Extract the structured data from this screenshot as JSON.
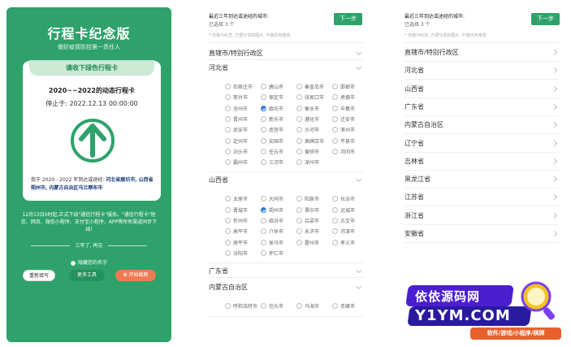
{
  "card": {
    "title": "行程卡纪念版",
    "subtitle": "做好疫情防控第一责任人",
    "ticket_header": "请收下绿色行程卡",
    "line1": "2020~~2022的动态行程卡",
    "line2": "停止于: 2022.12.13 00:00:00",
    "desc_prefix": "我于 2020 - 2022 年到达或途经:",
    "desc_places": "河北省廊坊市, 山西省朔州市, 内蒙古自治区乌兰察布市",
    "notice": "12月13日0时起,正式下线\"通信行程卡\"服务。\"通信行程卡\"短信、网页、微信小程序、支付宝小程序、APP等所有渠道同步下线!",
    "divider_text": "三年了, 再见",
    "hide_name": "隐藏您的名字",
    "btn_refill": "重新填写",
    "btn_tools": "更多工具",
    "btn_screenshot": "开始截图",
    "arrow_color": "#2ea26a"
  },
  "middle": {
    "title": "最近三年到达或途经的城市:",
    "selected": "已选择 3 个",
    "tip": "* 仅做为纪念, 方便分享的图片, 不做任何用途",
    "next": "下一步",
    "groups": [
      {
        "name": "直辖市/特别行政区",
        "expanded": false
      },
      {
        "name": "河北省",
        "expanded": true,
        "cities": [
          [
            "石家庄市",
            "唐山市",
            "秦皇岛市",
            "邯郸市"
          ],
          [
            "邢台市",
            "保定市",
            "张家口市",
            "承德市"
          ],
          [
            "沧州市",
            "廊坊市",
            "衡水市",
            "辛集市"
          ],
          [
            "晋州市",
            "新乐市",
            "遵化市",
            "迁安市"
          ],
          [
            "武安市",
            "南宫市",
            "沙河市",
            "涿州市"
          ],
          [
            "定州市",
            "安国市",
            "高碑店市",
            "平泉市"
          ],
          [
            "泊头市",
            "任丘市",
            "黄骅市",
            "河间市"
          ],
          [
            "霸州市",
            "三河市",
            "深州市"
          ]
        ],
        "checked": "廊坊市"
      },
      {
        "name": "山西省",
        "expanded": true,
        "cities": [
          [
            "太原市",
            "大同市",
            "阳泉市",
            "长治市"
          ],
          [
            "晋城市",
            "朔州市",
            "晋中市",
            "运城市"
          ],
          [
            "忻州市",
            "临汾市",
            "吕梁市",
            "古交市"
          ],
          [
            "高平市",
            "介休市",
            "永济市",
            "河津市"
          ],
          [
            "原平市",
            "侯马市",
            "霍州市",
            "孝义市"
          ],
          [
            "汾阳市",
            "怀仁市"
          ]
        ],
        "checked": "朔州市"
      },
      {
        "name": "广东省",
        "expanded": false
      },
      {
        "name": "内蒙古自治区",
        "expanded": true,
        "cities": [
          [
            "呼和浩特市",
            "包头市",
            "乌海市",
            "赤峰市"
          ]
        ]
      }
    ]
  },
  "right": {
    "title": "最近三年到达或途经的城市:",
    "selected": "已选择 3 个",
    "tip": "* 仅做为纪念, 方便分享的图片, 不做任何用途",
    "next": "下一步",
    "groups": [
      "直辖市/特别行政区",
      "河北省",
      "山西省",
      "广东省",
      "内蒙古自治区",
      "辽宁省",
      "吉林省",
      "黑龙江省",
      "江苏省",
      "浙江省",
      "安徽省"
    ]
  },
  "watermark": {
    "line1": "依依源码网",
    "line2": "Y1YM.COM",
    "tag": "软件/游戏/小程序/棋牌"
  }
}
